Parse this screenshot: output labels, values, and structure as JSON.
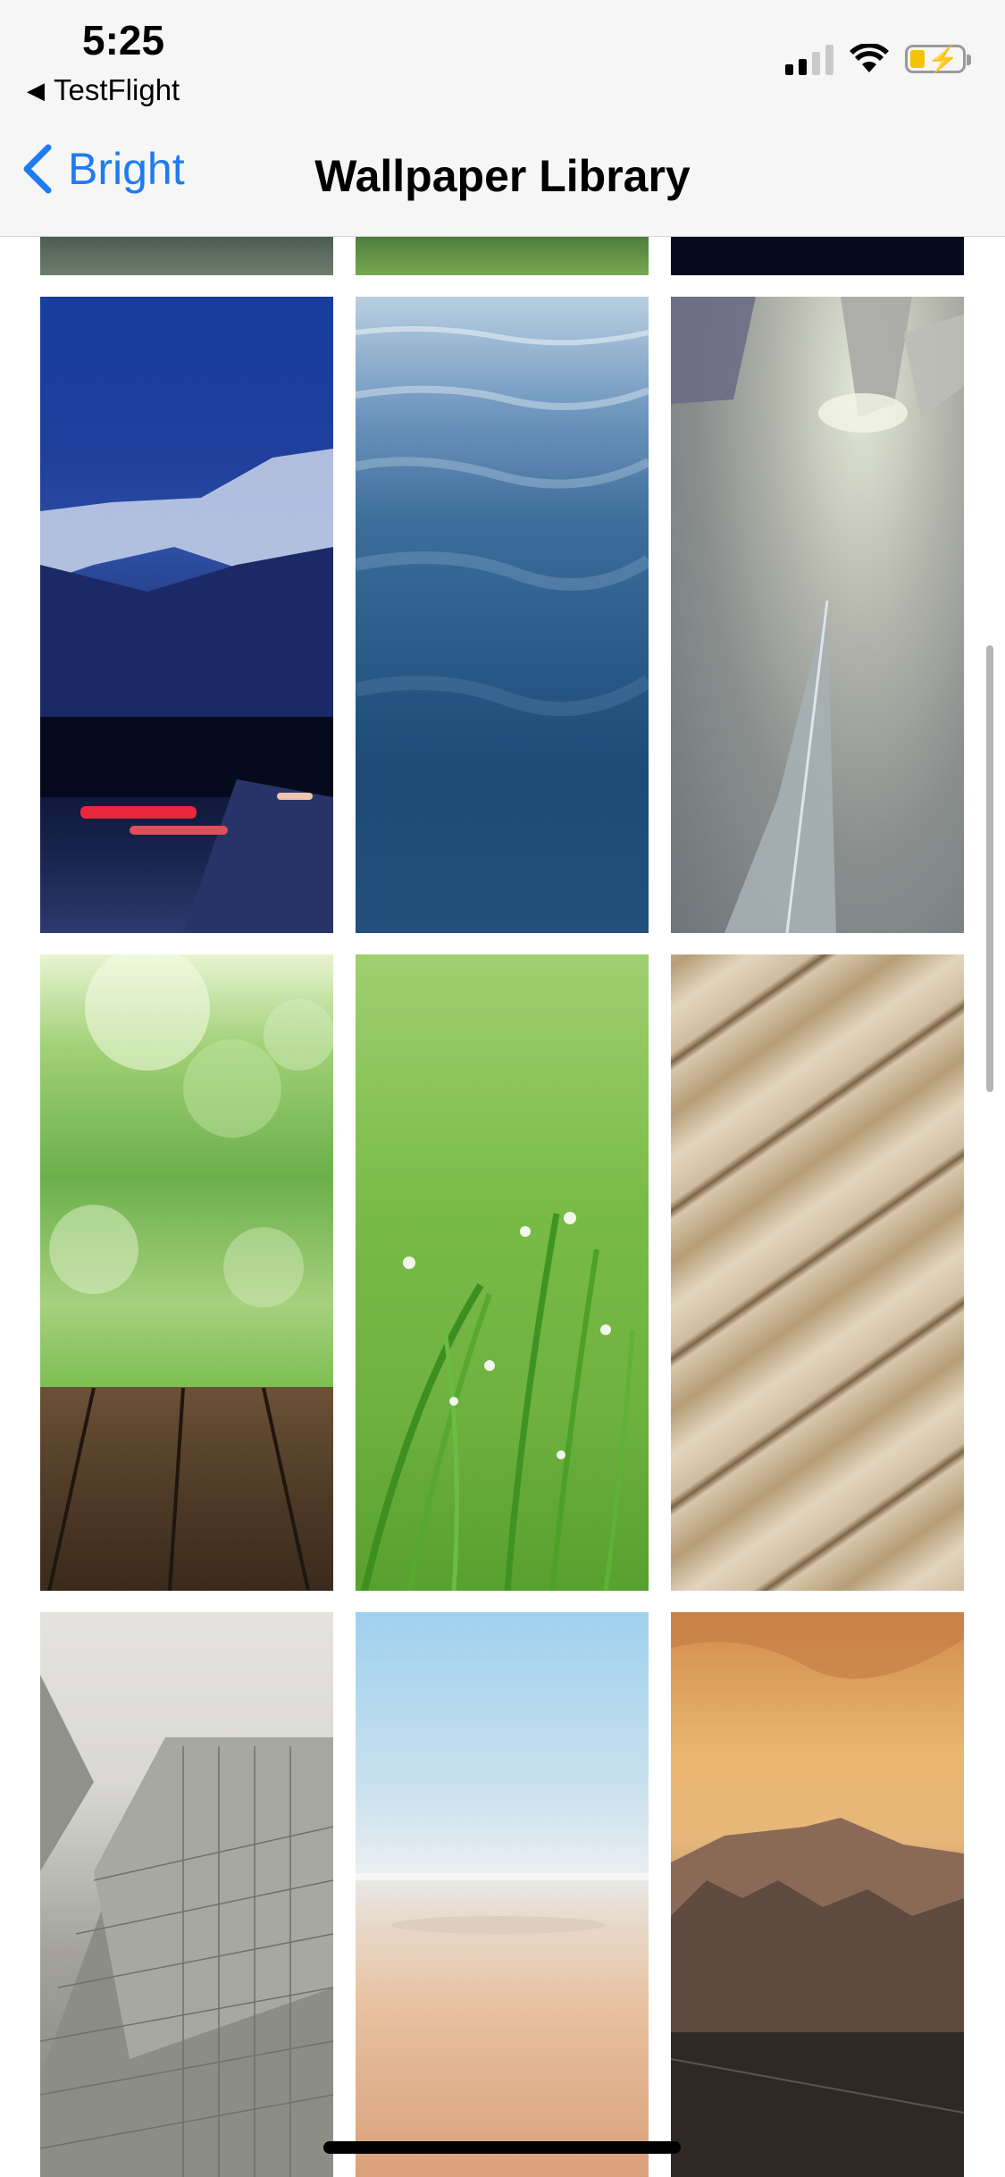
{
  "status_bar": {
    "time": "5:25",
    "back_app_label": "TestFlight",
    "signal_bars_active": 2,
    "signal_bars_total": 4,
    "battery_level": 0.3,
    "battery_charging": true
  },
  "nav": {
    "back_label": "Bright",
    "title": "Wallpaper Library"
  },
  "colors": {
    "accent": "#1e7bf2",
    "header_bg": "#f6f6f6",
    "battery_fill": "#f5c400"
  },
  "wallpapers": [
    {
      "name": "mountain-road-night",
      "row": 1,
      "col": 1
    },
    {
      "name": "blue-water",
      "row": 1,
      "col": 2
    },
    {
      "name": "foggy-skyscrapers",
      "row": 1,
      "col": 3
    },
    {
      "name": "green-bokeh-wood",
      "row": 2,
      "col": 1
    },
    {
      "name": "grass-dewdrops",
      "row": 2,
      "col": 2
    },
    {
      "name": "wooden-planks",
      "row": 2,
      "col": 3
    },
    {
      "name": "glass-building",
      "row": 3,
      "col": 1
    },
    {
      "name": "beach-horizon",
      "row": 3,
      "col": 2
    },
    {
      "name": "desert-mountains",
      "row": 3,
      "col": 3
    }
  ]
}
